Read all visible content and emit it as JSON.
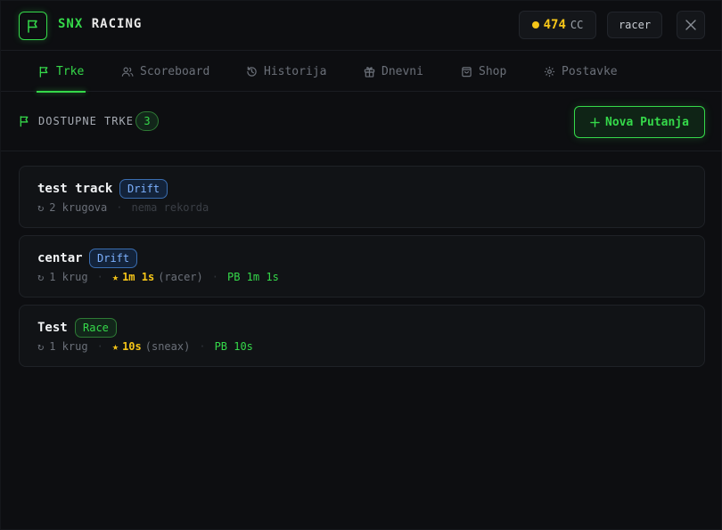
{
  "header": {
    "brand_accent": "SNX",
    "brand_rest": "RACING",
    "balance_value": "474",
    "balance_unit": "CC",
    "username": "racer"
  },
  "tabs": [
    {
      "label": "Trke",
      "icon": "flag-icon",
      "active": true
    },
    {
      "label": "Scoreboard",
      "icon": "users-icon",
      "active": false
    },
    {
      "label": "Historija",
      "icon": "history-icon",
      "active": false
    },
    {
      "label": "Dnevni",
      "icon": "gift-icon",
      "active": false
    },
    {
      "label": "Shop",
      "icon": "shopping-bag-icon",
      "active": false
    },
    {
      "label": "Postavke",
      "icon": "gear-icon",
      "active": false
    }
  ],
  "section": {
    "title": "DOSTUPNE TRKE",
    "count": "3",
    "new_button": "Nova Putanja"
  },
  "tracks": [
    {
      "name": "test track",
      "mode": "Drift",
      "laps": "2 krugova",
      "no_record": "nema rekorda"
    },
    {
      "name": "centar",
      "mode": "Drift",
      "laps": "1 krug",
      "record_time": "1m 1s",
      "record_holder": "(racer)",
      "pb": "PB 1m 1s"
    },
    {
      "name": "Test",
      "mode": "Race",
      "laps": "1 krug",
      "record_time": "10s",
      "record_holder": "(sneax)",
      "pb": "PB 10s"
    }
  ],
  "colors": {
    "accent": "#35d94a",
    "gold": "#f5c518",
    "drift": "#7eb2ff",
    "background": "#0d0e11"
  }
}
